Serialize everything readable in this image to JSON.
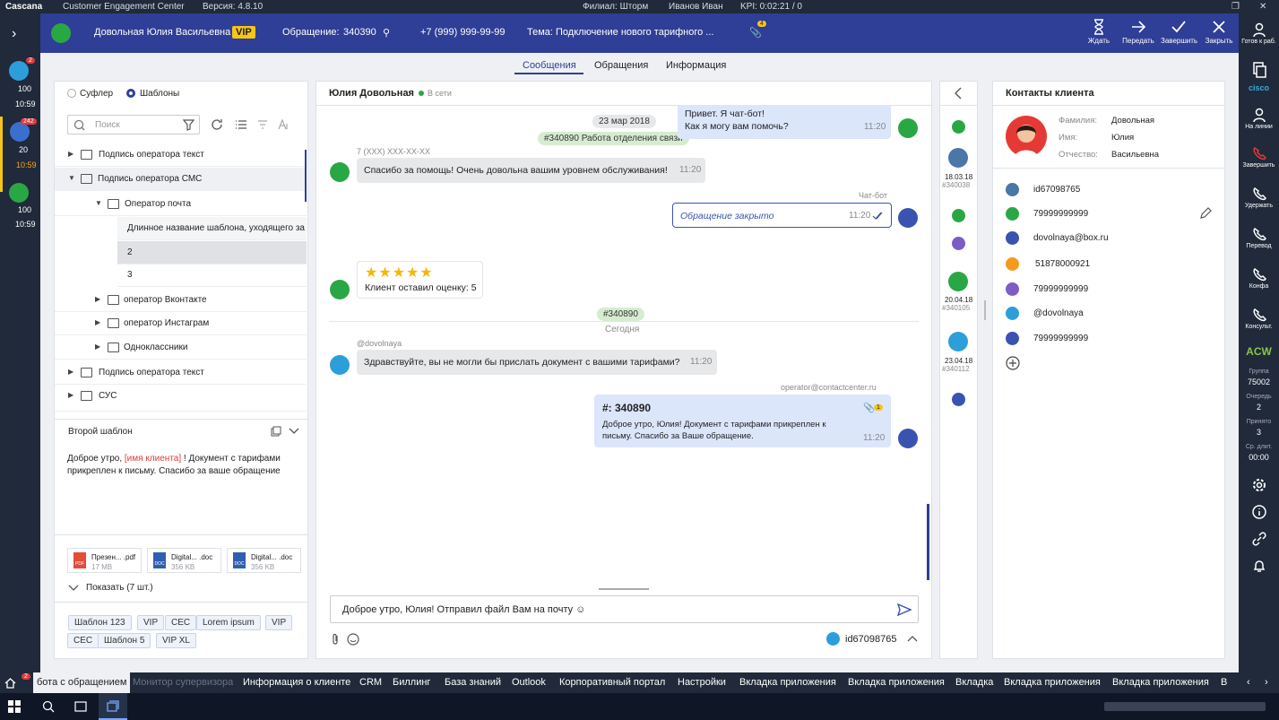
{
  "titlebar": {
    "app": "Cascana",
    "product": "Customer Engagement Center",
    "version": "Версия: 4.8.10",
    "branch": "Филиал: Шторм",
    "user": "Иванов Иван",
    "kpi": "KPI: 0:02:21 / 0"
  },
  "header": {
    "client_name": "Довольная Юлия Васильевна",
    "vip": "VIP",
    "ticket_label": "Обращение:",
    "ticket_number": "340390",
    "phone": "+7 (999) 999-99-99",
    "topic": "Тема: Подключение нового тарифного ...",
    "attach_count": "4",
    "actions": {
      "wait": "Ждать",
      "transfer": "Передать",
      "complete": "Завершить",
      "close": "Закрыть"
    }
  },
  "left_channels": [
    {
      "badge": "2",
      "count": "100",
      "time": "10:59",
      "color": "#2c9fdb"
    },
    {
      "badge": "242",
      "count": "20",
      "time": "10:59",
      "color": "#3a6fd0"
    },
    {
      "badge": "",
      "count": "100",
      "time": "10:59",
      "color": "#2aa745"
    }
  ],
  "tabs": {
    "messages": "Сообщения",
    "requests": "Обращения",
    "info": "Информация"
  },
  "left_panel": {
    "radio_prompter": "Суфлер",
    "radio_templates": "Шаблоны",
    "search_placeholder": "Поиск",
    "tree": [
      {
        "label": "Подпись оператора текст"
      },
      {
        "label": "Подпись оператора СМС"
      },
      {
        "label": "Оператор почта"
      },
      {
        "label": "Длинное название  шаблона, уходящего за"
      },
      {
        "label": "2"
      },
      {
        "label": "3"
      },
      {
        "label": "оператор Вконтакте"
      },
      {
        "label": "оператор Инстаграм"
      },
      {
        "label": "Одноклассники"
      },
      {
        "label": "Подпись оператора текст"
      },
      {
        "label": "СУС"
      }
    ],
    "preview_title": "Второй шаблон",
    "preview_text_1": "Доброе утро, ",
    "preview_var": "[имя клиента]",
    "preview_text_2": " ! Документ с тарифами прикреплен к письму. Спасибо за ваше обращение",
    "files": [
      {
        "name": "Презен... .pdf",
        "size": "17 MB",
        "type": "PDF"
      },
      {
        "name": "Digital... .doc",
        "size": "356 KB",
        "type": "DOC"
      },
      {
        "name": "Digital... .doc",
        "size": "356 KB",
        "type": "DOC"
      }
    ],
    "show_more": "Показать (7 шт.)",
    "tags": [
      "Шаблон 123",
      "VIP",
      "CEC",
      "Lorem ipsum",
      "VIP",
      "CEC",
      "Шаблон 5",
      "VIP XL"
    ]
  },
  "chat": {
    "contact": "Юлия Довольная",
    "status": "В сети",
    "date1": "23 мар 2018",
    "ticket_pill1": "#340890  Работа отделения связи",
    "bot_greeting_1": "Привет. Я чат-бот!",
    "bot_greeting_2": "Как я могу вам помочь?",
    "bot_time": "11:20",
    "sender_phone": "7 (XXX) XXX-XX-XX",
    "msg_thanks": "Спасибо за помощь! Очень довольна вашим уровнем обслуживания!",
    "msg_thanks_time": "11:20",
    "bot_label": "Чат-бот",
    "closed": "Обращение закрыто",
    "closed_time": "11:20",
    "rating_text": "Клиент оставил оценку: 5",
    "ticket_pill2": "#340890",
    "today": "Сегодня",
    "tg_sender": "@dovolnaya",
    "msg_doc": "Здравствуйте, вы не могли бы прислать документ с вашими тарифами?",
    "msg_doc_time": "11:20",
    "mail_from": "operator@contactcenter.ru",
    "mail_ticket": "#: 340890",
    "mail_body": "Доброе утро, Юлия! Документ с тарифами прикреплен к письму. Спасибо за Ваше обращение.",
    "mail_time": "11:20",
    "mail_attach_count": "1",
    "input_value": "Доброе утро, Юлия! Отправил файл Вам на почту ☺",
    "channel_id": "id67098765"
  },
  "history": [
    {
      "date": "18.03.18",
      "ticket": "#340038"
    },
    {
      "date": "20.04.18",
      "ticket": "#340105"
    },
    {
      "date": "23.04.18",
      "ticket": "#340112"
    }
  ],
  "contacts": {
    "title": "Контакты клиента",
    "lastname_label": "Фамилия:",
    "lastname": "Довольная",
    "firstname_label": "Имя:",
    "firstname": "Юлия",
    "middlename_label": "Отчество:",
    "middlename": "Васильевна",
    "items": [
      {
        "value": "id67098765",
        "icon": "vk-icon",
        "color": "#4a76a8"
      },
      {
        "value": "79999999999",
        "icon": "whatsapp-icon",
        "color": "#2aa745"
      },
      {
        "value": "dovolnaya@box.ru",
        "icon": "mail-icon",
        "color": "#3a53b0"
      },
      {
        "value": "51878000921",
        "icon": "ok-icon",
        "color": "#f59a1f"
      },
      {
        "value": "79999999999",
        "icon": "viber-icon",
        "color": "#7d5cc5"
      },
      {
        "value": "@dovolnaya",
        "icon": "telegram-icon",
        "color": "#2c9fdb"
      },
      {
        "value": "79999999999",
        "icon": "phone-icon",
        "color": "#3a53b0"
      }
    ]
  },
  "right_strip": {
    "ready": "Готов к раб.",
    "online": "На линии",
    "end": "Завершить",
    "hold": "Удержать",
    "transfer": "Перевод",
    "conf": "Конфа",
    "consult": "Консульт.",
    "acw": "ACW",
    "group_label": "Группа",
    "group": "75002",
    "queue_label": "Очередь",
    "queue": "2",
    "accepted_label": "Принято",
    "accepted": "3",
    "avg_label": "Ср. длит.",
    "avg": "00:00"
  },
  "bottom_tabs": [
    "бота с обращением",
    "Монитор супервизора",
    "Информация о клиенте",
    "CRM",
    "Биллинг",
    "База знаний",
    "Outlook",
    "Корпоративный портал",
    "Настройки",
    "Вкладка приложения",
    "Вкладка приложения",
    "Вкладка",
    "Вкладка приложения",
    "Вкладка приложения",
    "В"
  ],
  "bottom_badge": "2"
}
